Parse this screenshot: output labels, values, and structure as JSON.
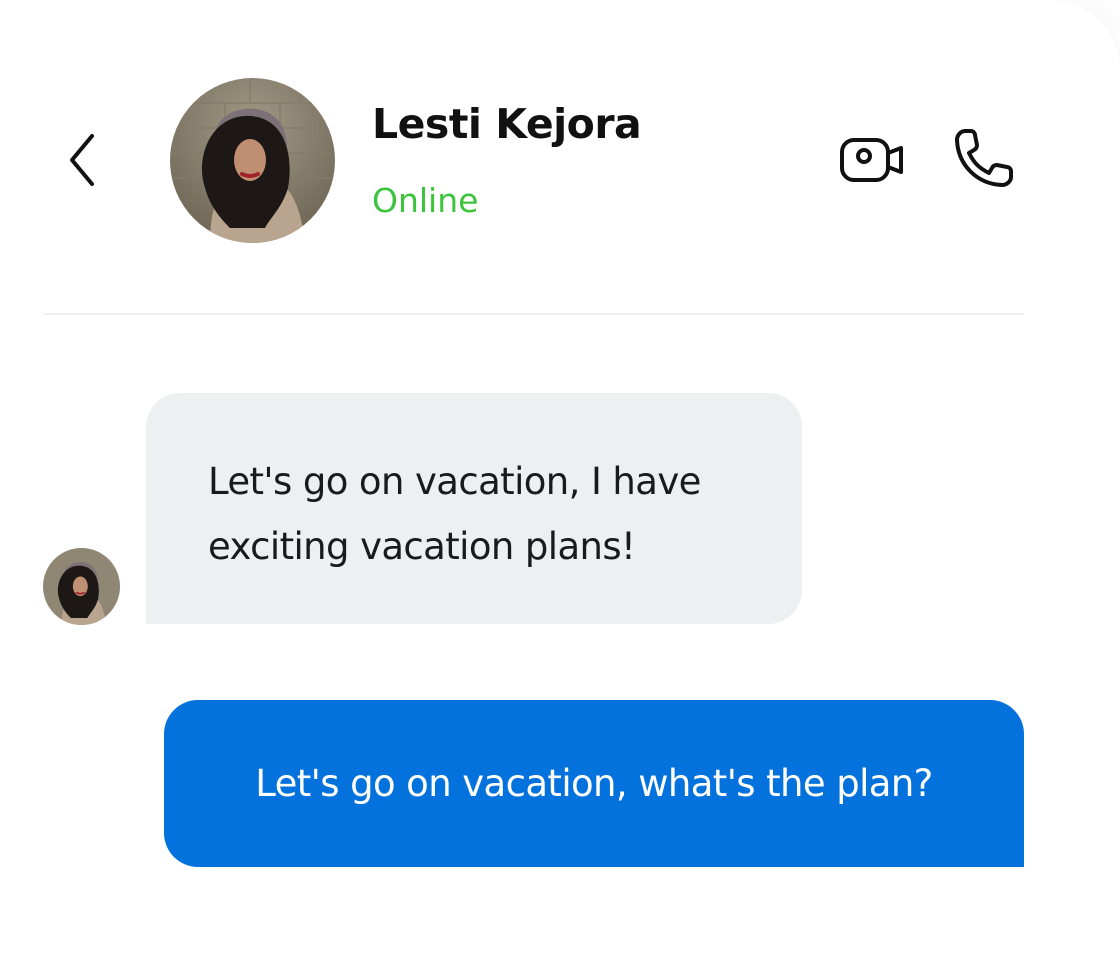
{
  "header": {
    "contact_name": "Lesti Kejora",
    "status": "Online",
    "back_icon": "chevron-left-icon",
    "video_icon": "video-camera-icon",
    "call_icon": "phone-icon"
  },
  "messages": [
    {
      "direction": "incoming",
      "text": "Let's go on vacation, I have exciting vacation plans!"
    },
    {
      "direction": "outgoing",
      "text": "Let's go on vacation, what's the plan?"
    }
  ],
  "colors": {
    "status_online": "#3cc43c",
    "outgoing_bubble": "#0372dc",
    "incoming_bubble": "#eeeff1"
  }
}
